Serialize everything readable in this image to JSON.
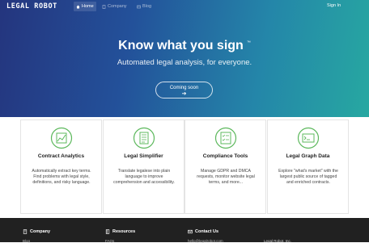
{
  "nav": {
    "logo": "LEGAL ROBOT",
    "links": [
      {
        "label": "Home",
        "icon": "home-icon"
      },
      {
        "label": "Company",
        "icon": "document-icon"
      },
      {
        "label": "Blog",
        "icon": "newspaper-icon"
      }
    ],
    "signin": "Sign In"
  },
  "hero": {
    "title": "Know what you sign",
    "trademark": "™",
    "subtitle": "Automated legal analysis, for everyone.",
    "cta_label": "Coming soon",
    "cta_icon": "arrow-right-icon"
  },
  "features": [
    {
      "title": "Contract Analytics",
      "icon": "chart-icon",
      "description": "Automatically extract key terms. Find problems with legal style, definitions, and risky language."
    },
    {
      "title": "Legal Simplifier",
      "icon": "document-lines-icon",
      "description": "Translate legalese into plain language to improve comprehension and accessibility."
    },
    {
      "title": "Compliance Tools",
      "icon": "checklist-icon",
      "description": "Manage GDPR and DMCA requests, monitor website legal terms, and more..."
    },
    {
      "title": "Legal Graph Data",
      "icon": "terminal-icon",
      "description": "Explore \"what's market\" with the largest public source of tagged and enriched contracts."
    }
  ],
  "footer": {
    "columns": [
      {
        "title": "Company",
        "icon": "building-icon",
        "first_item": "Blog"
      },
      {
        "title": "Resources",
        "icon": "book-icon",
        "first_item": "FAQs"
      },
      {
        "title": "Contact Us",
        "icon": "envelope-icon",
        "first_item": "hello@legalrobot.com"
      }
    ],
    "brand": "Legal Robot, Inc."
  },
  "colors": {
    "hero_gradient": [
      "#24357e",
      "#2486a9",
      "#27a8a1"
    ],
    "icon_green": "#5cb85c",
    "footer_bg": "#212121"
  }
}
